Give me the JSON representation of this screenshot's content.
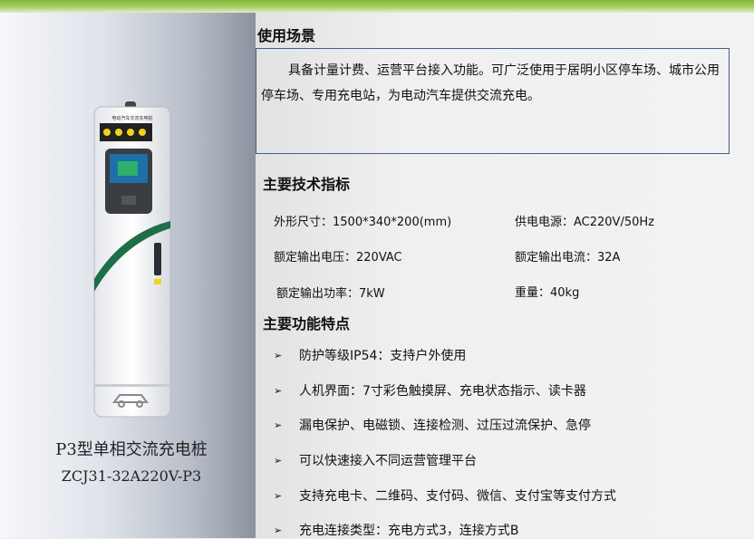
{
  "product": {
    "name": "P3型单相交流充电桩",
    "model": "ZCJ31-32A220V-P3",
    "device_label": "电动汽车交流充电桩"
  },
  "usage": {
    "title": "使用场景",
    "description": "具备计量计费、运营平台接入功能。可广泛使用于居明小区停车场、城市公用停车场、专用充电站，为电动汽车提供交流充电。"
  },
  "specs": {
    "title": "主要技术指标",
    "items": [
      "外形尺寸：1500*340*200(mm)",
      "供电电源：AC220V/50Hz",
      "额定输出电压：220VAC",
      "额定输出电流：32A",
      "额定输出功率：7kW",
      "重量：40kg"
    ]
  },
  "features": {
    "title": "主要功能特点",
    "items": [
      "防护等级IP54：支持户外使用",
      "人机界面：7寸彩色触摸屏、充电状态指示、读卡器",
      "漏电保护、电磁锁、连接检测、过压过流保护、急停",
      "可以快速接入不同运营管理平台",
      "支持充电卡、二维码、支付码、微信、支付宝等支付方式",
      "充电连接类型：充电方式3，连接方式B"
    ]
  },
  "colors": {
    "accent_green": "#7fb83a",
    "box_border": "#3f5f8c",
    "charger_swoosh": "#1f6e4a"
  }
}
